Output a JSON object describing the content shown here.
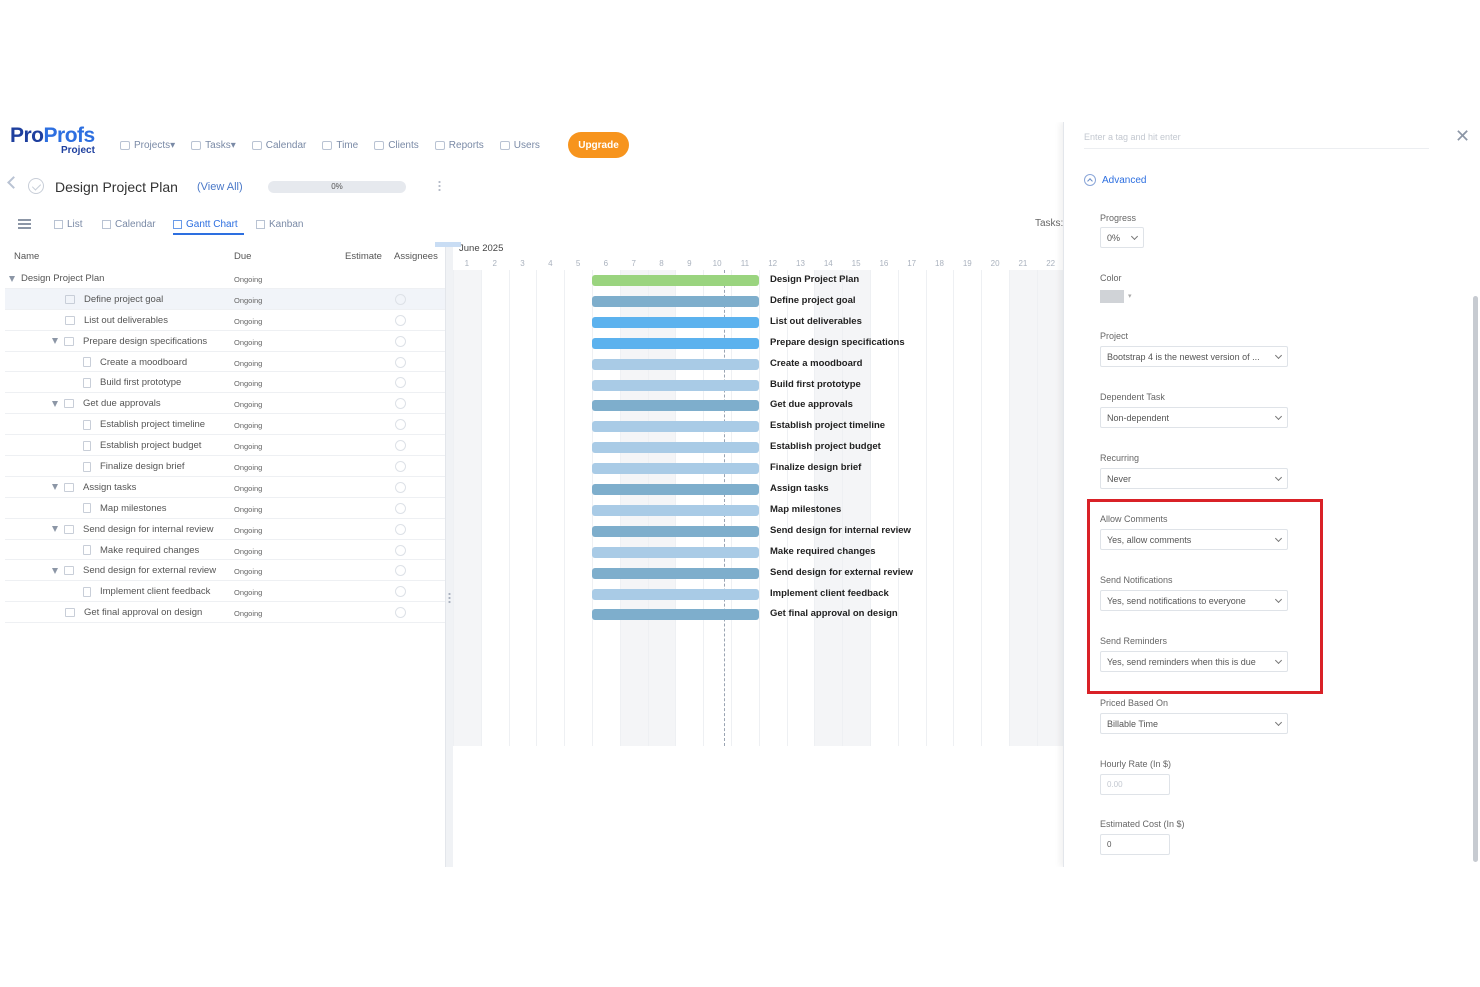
{
  "brand": {
    "name_part1": "Pro",
    "name_part2": "Profs",
    "product": "Project"
  },
  "nav": {
    "items": [
      {
        "label": "Projects",
        "caret": "▾"
      },
      {
        "label": "Tasks",
        "caret": "▾"
      },
      {
        "label": "Calendar",
        "caret": ""
      },
      {
        "label": "Time",
        "caret": ""
      },
      {
        "label": "Clients",
        "caret": ""
      },
      {
        "label": "Reports",
        "caret": ""
      },
      {
        "label": "Users",
        "caret": ""
      }
    ],
    "upgrade_label": "Upgrade"
  },
  "project": {
    "title": "Design Project Plan",
    "view_all": "(View All)",
    "progress_label": "0%",
    "progress_value": 0
  },
  "views": {
    "tabs": [
      "List",
      "Calendar",
      "Gantt Chart",
      "Kanban"
    ],
    "active": "Gantt Chart",
    "tasks_label": "Tasks:"
  },
  "table": {
    "headers": {
      "name": "Name",
      "due": "Due",
      "estimate": "Estimate",
      "assignees": "Assignees"
    },
    "rows": [
      {
        "name": "Design Project Plan",
        "due": "Ongoing",
        "level": 0,
        "expanded": true,
        "icon": "none",
        "bar_color": "#9ad47f"
      },
      {
        "name": "Define project goal",
        "due": "Ongoing",
        "level": 1,
        "expanded": false,
        "icon": "folder-icon",
        "bar_color": "#7eaecc",
        "selected": true
      },
      {
        "name": "List out deliverables",
        "due": "Ongoing",
        "level": 1,
        "expanded": false,
        "icon": "folder-icon",
        "bar_color": "#5cb2ee"
      },
      {
        "name": "Prepare design specifications",
        "due": "Ongoing",
        "level": 1,
        "expanded": true,
        "icon": "folder-icon",
        "bar_color": "#5cb2ee"
      },
      {
        "name": "Create a moodboard",
        "due": "Ongoing",
        "level": 2,
        "expanded": false,
        "icon": "doc-icon",
        "bar_color": "#a9cbe6"
      },
      {
        "name": "Build first prototype",
        "due": "Ongoing",
        "level": 2,
        "expanded": false,
        "icon": "doc-icon",
        "bar_color": "#a9cbe6"
      },
      {
        "name": "Get due approvals",
        "due": "Ongoing",
        "level": 1,
        "expanded": true,
        "icon": "folder-icon",
        "bar_color": "#7eaecc"
      },
      {
        "name": "Establish project timeline",
        "due": "Ongoing",
        "level": 2,
        "expanded": false,
        "icon": "doc-icon",
        "bar_color": "#a9cbe6"
      },
      {
        "name": "Establish project budget",
        "due": "Ongoing",
        "level": 2,
        "expanded": false,
        "icon": "doc-icon",
        "bar_color": "#a9cbe6"
      },
      {
        "name": "Finalize design brief",
        "due": "Ongoing",
        "level": 2,
        "expanded": false,
        "icon": "doc-icon",
        "bar_color": "#a9cbe6"
      },
      {
        "name": "Assign tasks",
        "due": "Ongoing",
        "level": 1,
        "expanded": true,
        "icon": "folder-icon",
        "bar_color": "#7eaecc"
      },
      {
        "name": "Map milestones",
        "due": "Ongoing",
        "level": 2,
        "expanded": false,
        "icon": "doc-icon",
        "bar_color": "#a9cbe6"
      },
      {
        "name": "Send design for internal review",
        "due": "Ongoing",
        "level": 1,
        "expanded": true,
        "icon": "folder-icon",
        "bar_color": "#7eaecc"
      },
      {
        "name": "Make required changes",
        "due": "Ongoing",
        "level": 2,
        "expanded": false,
        "icon": "doc-icon",
        "bar_color": "#a9cbe6"
      },
      {
        "name": "Send design for external review",
        "due": "Ongoing",
        "level": 1,
        "expanded": true,
        "icon": "folder-icon",
        "bar_color": "#7eaecc"
      },
      {
        "name": "Implement client feedback",
        "due": "Ongoing",
        "level": 2,
        "expanded": false,
        "icon": "doc-icon",
        "bar_color": "#a9cbe6"
      },
      {
        "name": "Get final approval on design",
        "due": "Ongoing",
        "level": 1,
        "expanded": false,
        "icon": "folder-icon",
        "bar_color": "#7eaecc"
      }
    ]
  },
  "gantt": {
    "month": "June 2025",
    "days": [
      "1",
      "2",
      "3",
      "4",
      "5",
      "6",
      "7",
      "8",
      "9",
      "10",
      "11",
      "12",
      "13",
      "14",
      "15",
      "16",
      "17",
      "18",
      "19",
      "20",
      "21",
      "22"
    ],
    "weekend_days": [
      "1",
      "7",
      "8",
      "14",
      "15",
      "21",
      "22"
    ],
    "today": "9",
    "bar_start_day": "6",
    "bar_end_day": "11"
  },
  "panel": {
    "tag_placeholder": "Enter a tag and hit enter",
    "close_icon": "close-icon",
    "advanced_label": "Advanced",
    "progress": {
      "label": "Progress",
      "value": "0%"
    },
    "color": {
      "label": "Color",
      "value": "#d0d3d7"
    },
    "project": {
      "label": "Project",
      "value": "Bootstrap 4 is the newest version of ..."
    },
    "dependent_task": {
      "label": "Dependent Task",
      "value": "Non-dependent"
    },
    "recurring": {
      "label": "Recurring",
      "value": "Never"
    },
    "allow_comments": {
      "label": "Allow Comments",
      "value": "Yes, allow comments"
    },
    "send_notifications": {
      "label": "Send Notifications",
      "value": "Yes, send notifications to everyone"
    },
    "send_reminders": {
      "label": "Send Reminders",
      "value": "Yes, send reminders when this is due"
    },
    "priced_based_on": {
      "label": "Priced Based On",
      "value": "Billable Time"
    },
    "hourly_rate": {
      "label": "Hourly Rate (In $)",
      "placeholder": "0.00"
    },
    "estimated_cost": {
      "label": "Estimated Cost (In $)",
      "value": "0"
    }
  },
  "colors": {
    "accent": "#2d6fe0",
    "upgrade": "#f7941d",
    "highlight": "#d92127"
  }
}
